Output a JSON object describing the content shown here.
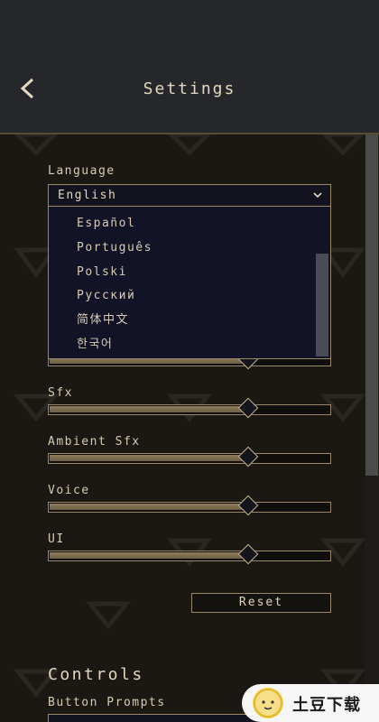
{
  "header": {
    "title": "Settings",
    "back_icon": "chevron-left-icon"
  },
  "language": {
    "label": "Language",
    "selected": "English",
    "chevron_icon": "chevron-down-icon",
    "options": [
      "Español",
      "Português",
      "Polski",
      "Русский",
      "简体中文",
      "한국어"
    ]
  },
  "audio": {
    "sfx_label": "Sfx",
    "sfx_level": 0.71,
    "ambient_label": "Ambient Sfx",
    "ambient_level": 0.71,
    "voice_label": "Voice",
    "voice_level": 0.71,
    "ui_label": "UI",
    "ui_level": 0.71,
    "hidden_level": 0.71
  },
  "reset_label": "Reset",
  "controls": {
    "title": "Controls",
    "button_prompts_label": "Button Prompts"
  },
  "watermark": {
    "text": "土豆下载"
  },
  "colors": {
    "header_bg": "#26272b",
    "body_bg": "#1b1813",
    "accent_gold": "#9a8866",
    "slider_fill": "#8f7d5c",
    "dropdown_bg": "#12131f"
  }
}
